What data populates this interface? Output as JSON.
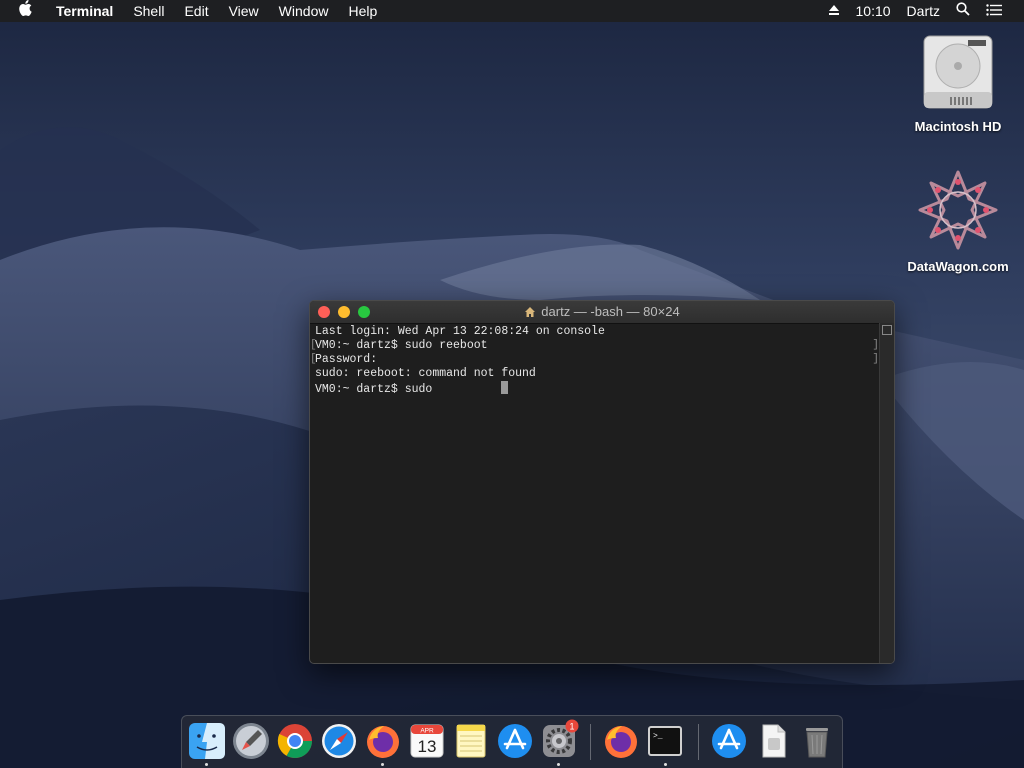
{
  "menubar": {
    "app": "Terminal",
    "items": [
      "Shell",
      "Edit",
      "View",
      "Window",
      "Help"
    ],
    "clock": "10:10",
    "user": "Dartz"
  },
  "desktop_icons": [
    {
      "label": "Macintosh HD",
      "icon": "hard-drive-icon"
    },
    {
      "label": "DataWagon.com",
      "icon": "datawagon-logo-icon"
    }
  ],
  "terminal": {
    "title": "dartz — -bash — 80×24",
    "lines": [
      "Last login: Wed Apr 13 22:08:24 on console",
      "VM0:~ dartz$ sudo reeboot",
      "Password:",
      "sudo: reeboot: command not found",
      "VM0:~ dartz$ sudo "
    ]
  },
  "dock": {
    "apps": [
      "finder-icon",
      "launchpad-icon",
      "chrome-icon",
      "safari-icon",
      "firefox-icon",
      "calendar-icon",
      "notes-icon",
      "app-store-icon",
      "system-preferences-icon",
      "firefox-icon",
      "terminal-icon",
      "app-store-icon",
      "file-icon",
      "trash-icon"
    ],
    "calendar_month": "APR",
    "calendar_day": "13",
    "system_prefs_badge": "1",
    "terminal_prompt": ">_"
  },
  "colors": {
    "close": "#fe5f57",
    "minimize": "#febc2e",
    "zoom": "#28c840",
    "terminal_bg": "#1e1e1e"
  }
}
